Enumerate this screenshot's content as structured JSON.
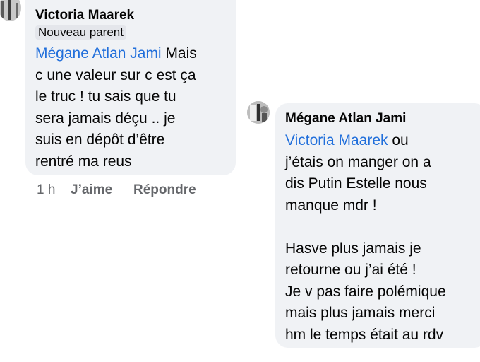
{
  "comment1": {
    "author": "Victoria Maarek",
    "badge": "Nouveau parent",
    "mention": "Mégane Atlan Jami",
    "lines": [
      " Mais",
      "c une valeur sur c est ça",
      "le truc ! tu sais que tu",
      "sera jamais déçu .. je",
      "suis en dépôt d’être",
      "rentré ma reus"
    ],
    "time": "1 h",
    "like_label": "J’aime",
    "reply_label": "Répondre"
  },
  "comment2": {
    "author": "Mégane Atlan Jami",
    "mention": "Victoria Maarek",
    "lines": [
      " ou",
      "j’étais on manger on a",
      "dis Putin Estelle nous",
      "manque mdr !",
      "",
      "Hasve plus jamais je",
      "retourne ou j’ai été !",
      "Je v pas faire polémique",
      "mais plus jamais merci",
      "hm le temps était au rdv"
    ]
  },
  "colors": {
    "bubble": "#f0f2f5",
    "mention": "#216fdb",
    "meta": "#65676b"
  },
  "icons": {
    "avatar1": "profile-photo",
    "avatar2": "profile-photo"
  }
}
